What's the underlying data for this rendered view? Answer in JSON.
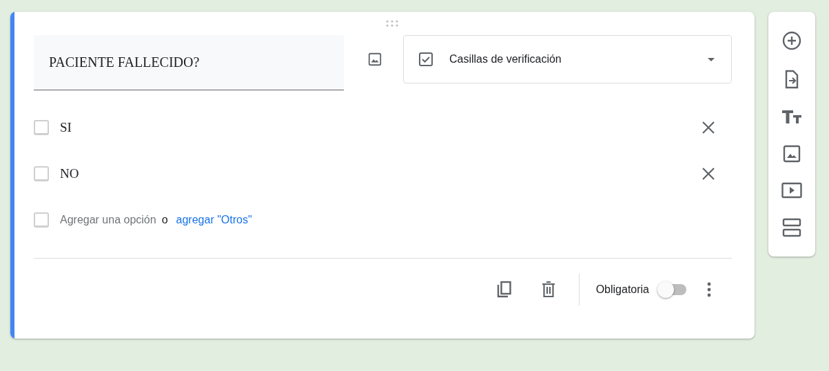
{
  "question": {
    "title": "PACIENTE FALLECIDO?",
    "type": "Casillas de verificación"
  },
  "options": [
    {
      "label": "SI",
      "checked": false
    },
    {
      "label": "NO",
      "checked": false
    }
  ],
  "add_option": {
    "checked": false,
    "placeholder": "Agregar una opción",
    "separator": "o",
    "link": "agregar \"Otros\""
  },
  "footer": {
    "required_label": "Obligatoria",
    "required_on": false
  }
}
